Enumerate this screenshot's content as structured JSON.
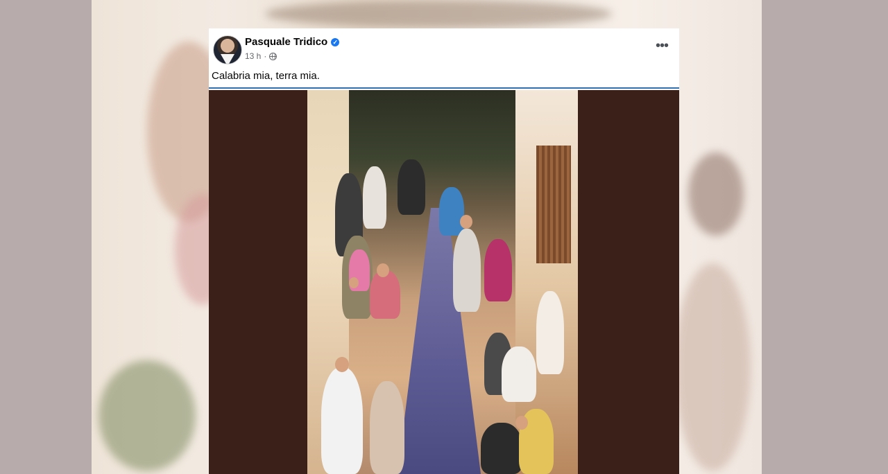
{
  "post": {
    "author": "Pasquale Tridico",
    "timestamp": "13 h",
    "visibility_icon": "globe-icon",
    "verified_icon": "verified-badge-icon",
    "more_label": "•••",
    "text": "Calabria mia, terra mia."
  },
  "colors": {
    "verified": "#1877f2",
    "divider": "#2f6fb3",
    "media_background": "#3a2019"
  }
}
